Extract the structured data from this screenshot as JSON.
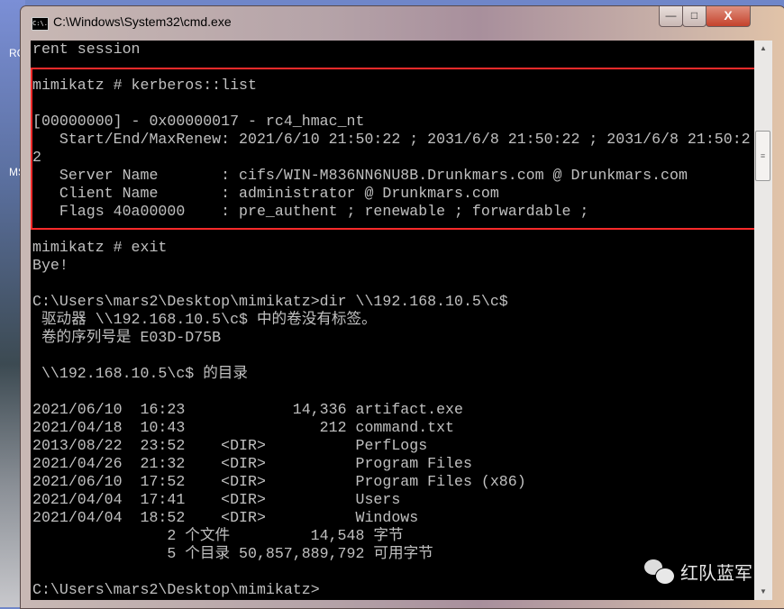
{
  "desktop": {
    "labels": [
      "RC",
      "MS"
    ]
  },
  "window": {
    "title": "C:\\Windows\\System32\\cmd.exe",
    "icon": "C:\\.",
    "controls": {
      "minimize": "—",
      "maximize": "□",
      "close": "X"
    }
  },
  "console": {
    "lines": [
      "rent session",
      "",
      "mimikatz # kerberos::list",
      "",
      "[00000000] - 0x00000017 - rc4_hmac_nt",
      "   Start/End/MaxRenew: 2021/6/10 21:50:22 ; 2031/6/8 21:50:22 ; 2031/6/8 21:50:2",
      "2",
      "   Server Name       : cifs/WIN-M836NN6NU8B.Drunkmars.com @ Drunkmars.com",
      "   Client Name       : administrator @ Drunkmars.com",
      "   Flags 40a00000    : pre_authent ; renewable ; forwardable ;",
      "",
      "mimikatz # exit",
      "Bye!",
      "",
      "C:\\Users\\mars2\\Desktop\\mimikatz>dir \\\\192.168.10.5\\c$",
      " 驱动器 \\\\192.168.10.5\\c$ 中的卷没有标签。",
      " 卷的序列号是 E03D-D75B",
      "",
      " \\\\192.168.10.5\\c$ 的目录",
      "",
      "2021/06/10  16:23            14,336 artifact.exe",
      "2021/04/18  10:43               212 command.txt",
      "2013/08/22  23:52    <DIR>          PerfLogs",
      "2021/04/26  21:32    <DIR>          Program Files",
      "2021/06/10  17:52    <DIR>          Program Files (x86)",
      "2021/04/04  17:41    <DIR>          Users",
      "2021/04/04  18:52    <DIR>          Windows",
      "               2 个文件         14,548 字节",
      "               5 个目录 50,857,889,792 可用字节",
      "",
      "C:\\Users\\mars2\\Desktop\\mimikatz>"
    ]
  },
  "watermark": {
    "text": "红队蓝军",
    "icon": "wechat-icon"
  },
  "colors": {
    "console_bg": "#000000",
    "console_fg": "#c0c0c0",
    "highlight": "#ff2a2a"
  }
}
